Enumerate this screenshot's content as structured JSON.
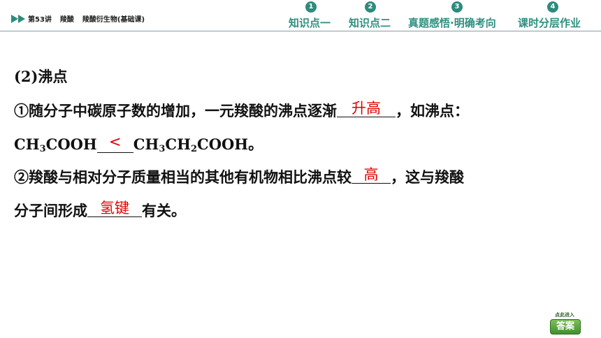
{
  "header": {
    "lesson": "第53讲",
    "topic": "羧酸",
    "subtitle": "羧酸衍生物(基础课)",
    "nav": [
      {
        "num": "1",
        "label": "知识点一"
      },
      {
        "num": "2",
        "label": "知识点二"
      },
      {
        "num": "3",
        "label": "真题感悟·明确考向"
      },
      {
        "num": "4",
        "label": "课时分层作业"
      }
    ]
  },
  "content": {
    "heading": "(2)沸点",
    "p1_text": "①随分子中碳原子数的增加，一元羧酸的沸点逐渐",
    "p1_answer": "升高",
    "p1_end": "，如沸点：",
    "p2_a_main": "CH",
    "p2_a_sub": "3",
    "p2_a_rest": "COOH",
    "p2_answer": "<",
    "p2_b_ch": "CH",
    "p2_b_sub1": "3",
    "p2_b_ch2": "CH",
    "p2_b_sub2": "2",
    "p2_b_rest": "COOH。",
    "p3_text": "②羧酸与相对分子质量相当的其他有机物相比沸点较",
    "p3_answer": "高",
    "p3_end": "，这与羧酸",
    "p4_text": "分子间形成",
    "p4_answer": "氢键",
    "p4_end": "有关。"
  },
  "answer_button": {
    "top_text": "点此进入",
    "label": "答案"
  },
  "colors": {
    "nav": "#2f8f7f",
    "answer": "#e00000"
  }
}
